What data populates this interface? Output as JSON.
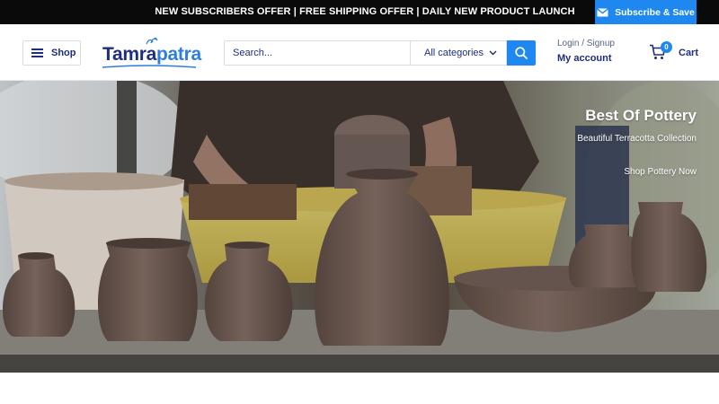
{
  "announcement": {
    "text": "NEW SUBSCRIBERS OFFER | FREE SHIPPING OFFER | DAILY NEW PRODUCT LAUNCH",
    "newsletter_label": "Subscribe & Save"
  },
  "header": {
    "shop_label": "Shop",
    "logo": {
      "part1": "Tamra",
      "part2": "patra"
    },
    "search": {
      "placeholder": "Search...",
      "category": "All categories"
    },
    "account": {
      "login_label": "Login / Signup",
      "account_label": "My account"
    },
    "cart": {
      "count": "0",
      "label": "Cart"
    }
  },
  "hero": {
    "title": "Best Of Pottery",
    "subtitle": "Beautiful Terracotta Collection",
    "link_label": "Shop Pottery Now"
  },
  "colors": {
    "accent": "#1e88f0",
    "text": "#1e2d7d",
    "announcement_bg": "#0a0a0a"
  },
  "icons": [
    "envelope-icon",
    "menu-icon",
    "search-icon",
    "chevron-down-icon",
    "cart-icon"
  ]
}
